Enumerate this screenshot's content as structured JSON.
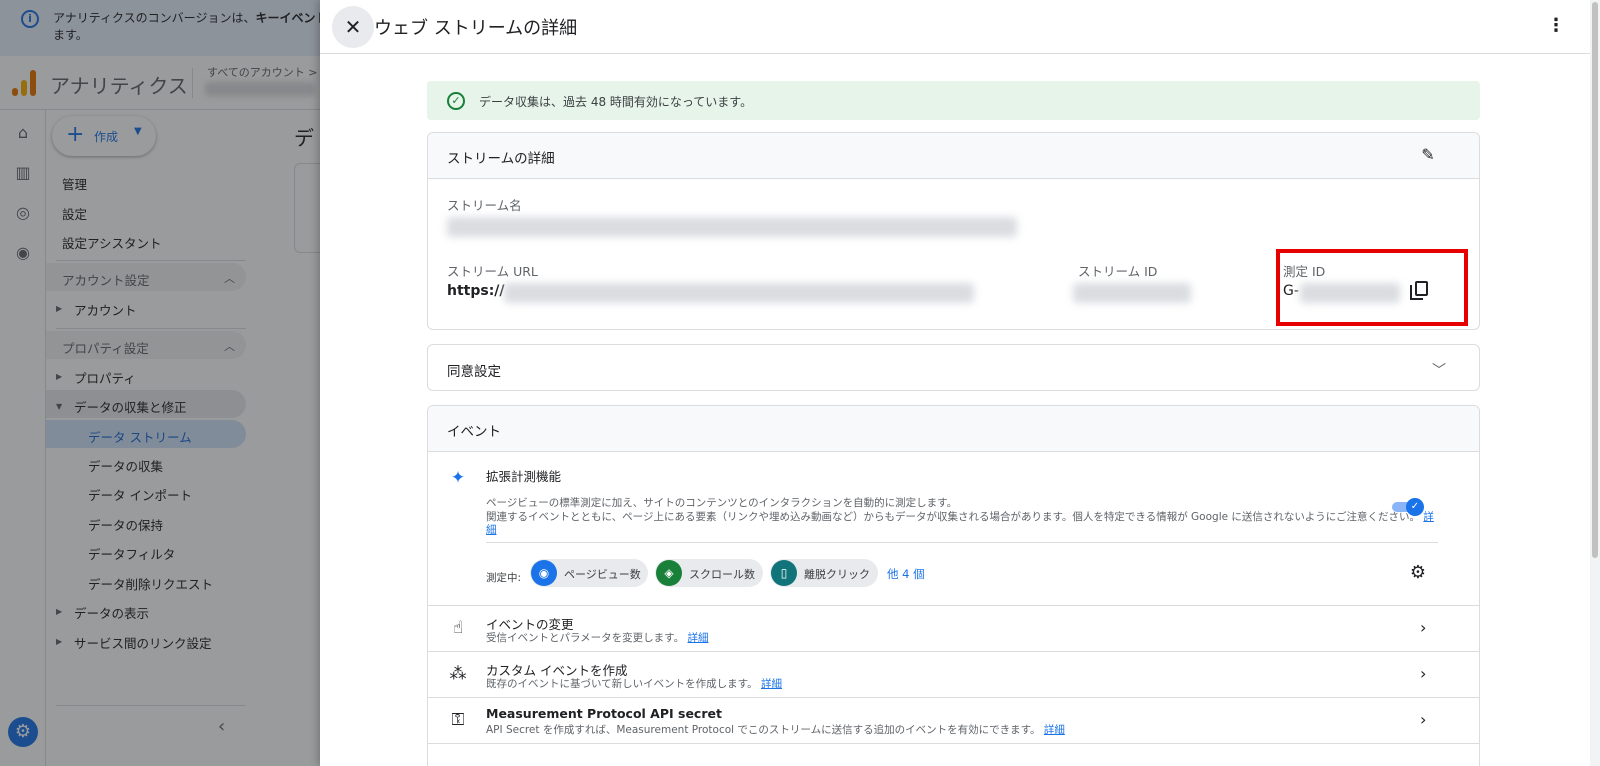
{
  "banner": {
    "text_before": "アナリティクスのコンバージョンは、",
    "text_bold": "キーイベント",
    "text_line2": "ます。"
  },
  "app": {
    "name": "アナリティクス",
    "account_crumb": "すべてのアカウント >"
  },
  "nav": {
    "create_label": "作成",
    "items": {
      "admin": "管理",
      "settings": "設定",
      "setup_assistant": "設定アシスタント"
    },
    "account_section": "アカウント設定",
    "account_item": "アカウント",
    "property_section": "プロパティ設定",
    "property_item": "プロパティ",
    "data_collection_group": "データの収集と修正",
    "sub_items": [
      "データ ストリーム",
      "データの収集",
      "データ インポート",
      "データの保持",
      "データフィルタ",
      "データ削除リクエスト"
    ],
    "data_display": "データの表示",
    "service_links": "サービス間のリンク設定"
  },
  "bg_main": {
    "title": "デ"
  },
  "panel": {
    "title": "ウェブ ストリームの詳細"
  },
  "status": {
    "text": "データ収集は、過去 48 時間有効になっています。",
    "color": "#188038"
  },
  "stream_details": {
    "title": "ストリームの詳細",
    "name_label": "ストリーム名",
    "url_label": "ストリーム URL",
    "url_value": "https://",
    "id_label": "ストリーム ID",
    "measurement_label": "測定 ID",
    "measurement_value": "G-"
  },
  "consent": {
    "title": "同意設定"
  },
  "events": {
    "title": "イベント",
    "enhanced": {
      "title": "拡張計測機能",
      "desc1": "ページビューの標準測定に加え、サイトのコンテンツとのインタラクションを自動的に測定します。",
      "desc2": "関連するイベントとともに、ページ上にある要素（リンクや埋め込み動画など）からもデータが収集される場合があります。個人を特定できる情報が Google に送信されないようにご注意ください。",
      "link_part1": "詳",
      "link_part2": "細",
      "measuring_label": "測定中:",
      "chips": [
        {
          "label": "ページビュー数",
          "icon": "eye-icon",
          "color": "#1a73e8"
        },
        {
          "label": "スクロール数",
          "icon": "scroll-icon",
          "color": "#188038"
        },
        {
          "label": "離脱クリック",
          "icon": "mouse-icon",
          "color": "#12747b"
        }
      ],
      "more": "他 4 個"
    },
    "rows": [
      {
        "title": "イベントの変更",
        "desc": "受信イベントとパラメータを変更します。",
        "link": "詳細",
        "icon": "touch-icon"
      },
      {
        "title": "カスタム イベントを作成",
        "desc": "既存のイベントに基づいて新しいイベントを作成します。",
        "link": "詳細",
        "icon": "sparkle-click-icon"
      },
      {
        "title": "Measurement Protocol API secret",
        "desc": "API Secret を作成すれば、Measurement Protocol でこのストリームに送信する追加のイベントを有効にできます。",
        "link": "詳細",
        "icon": "key-icon"
      }
    ]
  },
  "colors": {
    "accent": "#1a73e8",
    "highlight": "#e60000"
  }
}
